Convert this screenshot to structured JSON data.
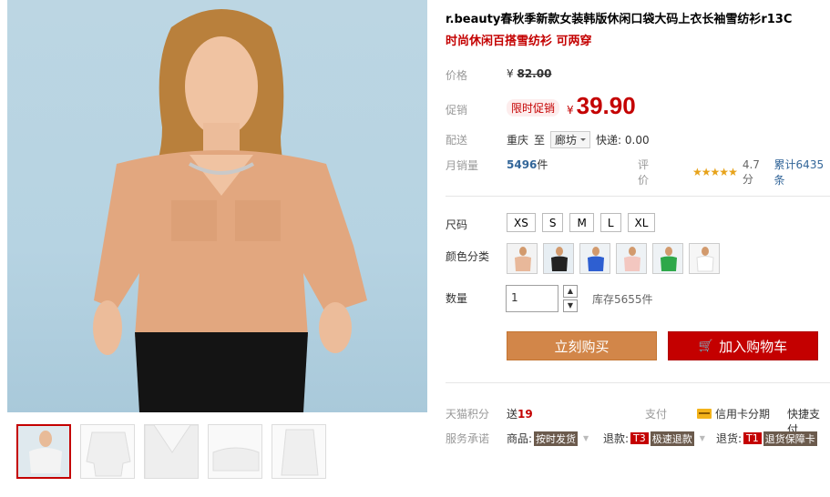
{
  "product": {
    "title": "r.beauty春秋季新款女装韩版休闲口袋大码上衣长袖雪纺衫r13C",
    "subtitle": "时尚休闲百搭雪纺衫 可两穿"
  },
  "labels": {
    "price": "价格",
    "promo": "促销",
    "delivery": "配送",
    "monthly_sales": "月销量",
    "size": "尺码",
    "color": "颜色分类",
    "quantity": "数量",
    "points": "天猫积分",
    "service": "服务承诺",
    "rating": "评价"
  },
  "price": {
    "currency": "¥",
    "original": "82.00",
    "promo_tag": "限时促销",
    "promo_value": "39.90"
  },
  "delivery": {
    "from": "重庆",
    "to_word": "至",
    "destination": "廊坊",
    "express": "快递: 0.00"
  },
  "sales": {
    "count": "5496",
    "unit": "件"
  },
  "rating": {
    "stars": "★★★★★",
    "score": 4.7,
    "score_text": "4.7分",
    "total": "累计6435条"
  },
  "sizes": [
    "XS",
    "S",
    "M",
    "L",
    "XL"
  ],
  "color_options": [
    {
      "name": "杏色",
      "color": "#e8b89a"
    },
    {
      "name": "黑色",
      "color": "#222222"
    },
    {
      "name": "蓝色",
      "color": "#2e5fd1"
    },
    {
      "name": "粉色",
      "color": "#f3c7c0"
    },
    {
      "name": "绿色",
      "color": "#2ea84a"
    },
    {
      "name": "白色",
      "color": "#f4f4f4"
    }
  ],
  "quantity": {
    "value": "1",
    "stock": "库存5655件",
    "up": "▲",
    "down": "▼"
  },
  "buttons": {
    "buy_now": "立刻购买",
    "add_cart": "加入购物车",
    "cart_icon": "🛒"
  },
  "points": {
    "prefix": "送",
    "value": "19"
  },
  "payment": {
    "label": "支付",
    "credit": "信用卡分期",
    "fast": "快捷支付"
  },
  "service": [
    {
      "prefix": "商品:",
      "badge": "按时发货",
      "red_code": ""
    },
    {
      "prefix": "退款:",
      "badge": "极速退款",
      "red_code": "T3"
    },
    {
      "prefix": "退货:",
      "badge": "退货保障卡",
      "red_code": "T1"
    }
  ],
  "colors": {
    "accent": "#c40000",
    "buy_button": "#d28649",
    "link": "#336699",
    "stars": "#e7a31b"
  }
}
